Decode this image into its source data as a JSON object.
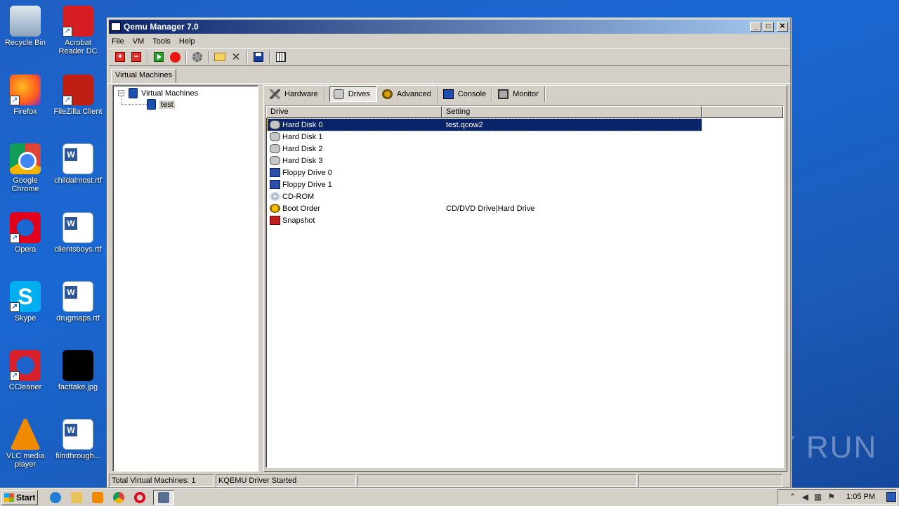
{
  "desktop": {
    "icons": [
      {
        "label": "Recycle Bin"
      },
      {
        "label": "Acrobat Reader DC"
      },
      {
        "label": "Firefox"
      },
      {
        "label": "FileZilla Client"
      },
      {
        "label": "Google Chrome"
      },
      {
        "label": "childalmost.rtf"
      },
      {
        "label": "Opera"
      },
      {
        "label": "clientsboys.rtf"
      },
      {
        "label": "Skype"
      },
      {
        "label": "drugmaps.rtf"
      },
      {
        "label": "CCleaner"
      },
      {
        "label": "facttake.jpg"
      },
      {
        "label": "VLC media player"
      },
      {
        "label": "filmthrough..."
      }
    ],
    "watermark": "ANY RUN"
  },
  "window": {
    "title": "Qemu Manager 7.0",
    "menu": [
      "File",
      "VM",
      "Tools",
      "Help"
    ],
    "outer_tab": "Virtual Machines",
    "tree": {
      "root": "Virtual Machines",
      "child": "test"
    },
    "tabs": [
      "Hardware",
      "Drives",
      "Advanced",
      "Console",
      "Monitor"
    ],
    "active_tab": "Drives",
    "columns": [
      "Drive",
      "Setting"
    ],
    "rows": [
      {
        "drive": "Hard Disk 0",
        "setting": "test.qcow2",
        "icon": "hard-disk-icon",
        "selected": true
      },
      {
        "drive": "Hard Disk 1",
        "setting": "",
        "icon": "hard-disk-icon"
      },
      {
        "drive": "Hard Disk 2",
        "setting": "",
        "icon": "hard-disk-icon"
      },
      {
        "drive": "Hard Disk 3",
        "setting": "",
        "icon": "hard-disk-icon"
      },
      {
        "drive": "Floppy Drive 0",
        "setting": "",
        "icon": "floppy-icon"
      },
      {
        "drive": "Floppy Drive 1",
        "setting": "",
        "icon": "floppy-icon"
      },
      {
        "drive": "CD-ROM",
        "setting": "",
        "icon": "cdrom-icon"
      },
      {
        "drive": "Boot Order",
        "setting": "CD/DVD Drive|Hard Drive",
        "icon": "boot-order-icon"
      },
      {
        "drive": "Snapshot",
        "setting": "",
        "icon": "snapshot-icon"
      }
    ],
    "status": {
      "total": "Total Virtual Machines: 1",
      "driver": "KQEMU Driver Started",
      "empty1": "",
      "empty2": ""
    }
  },
  "taskbar": {
    "start": "Start",
    "clock": "1:05 PM"
  },
  "colors": {
    "selection": "#0a246a",
    "titlebar_start": "#0a246a",
    "titlebar_end": "#a6caf0",
    "desktop": "#1a68d4"
  }
}
